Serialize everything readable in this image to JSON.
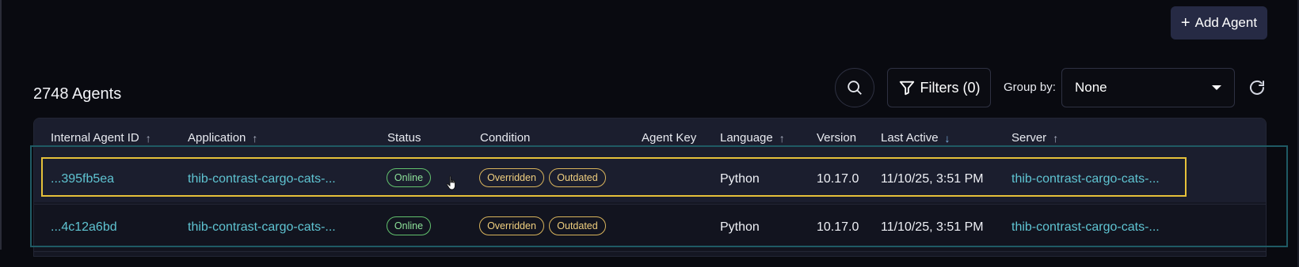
{
  "toolbar": {
    "add_agent_label": "Add Agent",
    "add_agent_plus": "+",
    "agent_count_title": "2748 Agents",
    "filters_label": "Filters (0)",
    "group_by_label": "Group by:",
    "group_by_value": "None"
  },
  "table": {
    "columns": [
      {
        "label": "Internal Agent ID",
        "sort": "↑"
      },
      {
        "label": "Application",
        "sort": "↑"
      },
      {
        "label": "Status",
        "sort": ""
      },
      {
        "label": "Condition",
        "sort": ""
      },
      {
        "label": "Agent Key",
        "sort": ""
      },
      {
        "label": "Language",
        "sort": "↑"
      },
      {
        "label": "Version",
        "sort": ""
      },
      {
        "label": "Last Active",
        "sort": "↓"
      },
      {
        "label": "Server",
        "sort": "↑"
      }
    ],
    "rows": [
      {
        "id": "...395fb5ea",
        "application": "thib-contrast-cargo-cats-...",
        "status": "Online",
        "conditions": [
          "Overridden",
          "Outdated"
        ],
        "agent_key": "",
        "language": "Python",
        "version": "10.17.0",
        "last_active": "11/10/25, 3:51 PM",
        "server": "thib-contrast-cargo-cats-..."
      },
      {
        "id": "...4c12a6bd",
        "application": "thib-contrast-cargo-cats-...",
        "status": "Online",
        "conditions": [
          "Overridden",
          "Outdated"
        ],
        "agent_key": "",
        "language": "Python",
        "version": "10.17.0",
        "last_active": "11/10/25, 3:51 PM",
        "server": "thib-contrast-cargo-cats-..."
      }
    ]
  },
  "colors": {
    "link": "#5fc4d2",
    "online": "#62c26e",
    "warning": "#d9b45c",
    "highlight": "#e6c13a",
    "selection": "#1f5a64"
  }
}
